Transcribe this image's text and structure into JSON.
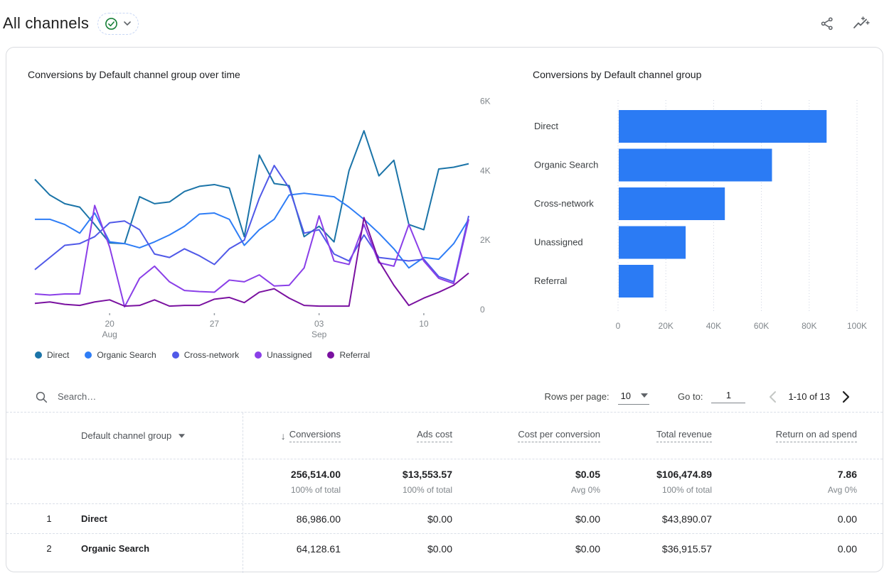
{
  "header": {
    "title": "All channels",
    "status": "verified",
    "accent_green": "#188038",
    "icon_grey": "#5f6368"
  },
  "chart_data": [
    {
      "type": "line",
      "title": "Conversions by Default channel group over time",
      "ylim": [
        0,
        6000
      ],
      "y_ticks": [
        {
          "v": 6000,
          "label": "6K"
        },
        {
          "v": 4000,
          "label": "4K"
        },
        {
          "v": 2000,
          "label": "2K"
        },
        {
          "v": 0,
          "label": "0"
        }
      ],
      "x_points": 30,
      "x_tick_labels": [
        {
          "i": 5,
          "label": "20",
          "sub": "Aug"
        },
        {
          "i": 12,
          "label": "27",
          "sub": ""
        },
        {
          "i": 19,
          "label": "03",
          "sub": "Sep"
        },
        {
          "i": 26,
          "label": "10",
          "sub": ""
        }
      ],
      "grid": false,
      "legend_position": "bottom",
      "series": [
        {
          "name": "Direct",
          "color": "#1b74a8",
          "values": [
            3750,
            3300,
            3050,
            2950,
            2450,
            1920,
            1900,
            3250,
            3050,
            3100,
            3400,
            3550,
            3600,
            3500,
            2100,
            4450,
            3630,
            3570,
            2100,
            2400,
            1950,
            4000,
            5150,
            3850,
            4300,
            2450,
            2300,
            4050,
            4100,
            4200
          ]
        },
        {
          "name": "Organic Search",
          "color": "#2e7df6",
          "values": [
            2600,
            2600,
            2450,
            2200,
            2780,
            1950,
            1900,
            1780,
            1950,
            2150,
            2400,
            2750,
            2780,
            2600,
            1850,
            2300,
            2600,
            3300,
            3350,
            3300,
            3250,
            2950,
            2600,
            2200,
            1750,
            1200,
            1500,
            1450,
            1900,
            2600
          ]
        },
        {
          "name": "Cross-network",
          "color": "#5059e8",
          "values": [
            1150,
            1500,
            1850,
            1900,
            2100,
            2500,
            2550,
            2300,
            1600,
            1500,
            1750,
            1550,
            1300,
            1750,
            2000,
            3200,
            4150,
            3500,
            2200,
            2300,
            1600,
            1400,
            2150,
            1500,
            1450,
            1400,
            1450,
            950,
            800,
            2700
          ]
        },
        {
          "name": "Unassigned",
          "color": "#8a3fe8",
          "values": [
            450,
            420,
            450,
            450,
            3000,
            1800,
            80,
            900,
            1250,
            800,
            550,
            520,
            500,
            850,
            800,
            1000,
            680,
            700,
            1200,
            2700,
            1400,
            1300,
            2450,
            1350,
            1250,
            2450,
            1400,
            900,
            750,
            2600
          ]
        },
        {
          "name": "Referral",
          "color": "#7a11a0",
          "values": [
            180,
            220,
            150,
            120,
            220,
            280,
            100,
            120,
            280,
            100,
            120,
            120,
            300,
            350,
            200,
            500,
            600,
            330,
            120,
            100,
            100,
            100,
            2650,
            1400,
            700,
            120,
            330,
            500,
            700,
            1050
          ]
        }
      ]
    },
    {
      "type": "bar",
      "orientation": "horizontal",
      "title": "Conversions by Default channel group",
      "categories": [
        "Direct",
        "Organic Search",
        "Cross-network",
        "Unassigned",
        "Referral"
      ],
      "values": [
        86986,
        64129,
        44400,
        28000,
        14500
      ],
      "xlim": [
        0,
        112000
      ],
      "x_ticks": [
        {
          "v": 0,
          "label": "0"
        },
        {
          "v": 20000,
          "label": "20K"
        },
        {
          "v": 40000,
          "label": "40K"
        },
        {
          "v": 60000,
          "label": "60K"
        },
        {
          "v": 80000,
          "label": "80K"
        },
        {
          "v": 100000,
          "label": "100K"
        }
      ],
      "bar_color": "#2b7bf4",
      "grid": "dotted-vertical"
    }
  ],
  "table": {
    "search": {
      "placeholder": "Search…"
    },
    "pagination": {
      "rows_per_page_label": "Rows per page:",
      "rows_per_page_value": "10",
      "go_to_label": "Go to:",
      "go_to_value": "1",
      "range_label": "1-10 of 13",
      "prev_enabled": false,
      "next_enabled": true
    },
    "columns": [
      "Default channel group",
      "Conversions",
      "Ads cost",
      "Cost per conversion",
      "Total revenue",
      "Return on ad spend"
    ],
    "sorted_column": "Conversions",
    "sort_direction": "desc",
    "totals": {
      "values": [
        "256,514.00",
        "$13,553.57",
        "$0.05",
        "$106,474.89",
        "7.86"
      ],
      "subtexts": [
        "100% of total",
        "100% of total",
        "Avg 0%",
        "100% of total",
        "Avg 0%"
      ]
    },
    "rows": [
      {
        "index": "1",
        "channel": "Direct",
        "values": [
          "86,986.00",
          "$0.00",
          "$0.00",
          "$43,890.07",
          "0.00"
        ]
      },
      {
        "index": "2",
        "channel": "Organic Search",
        "values": [
          "64,128.61",
          "$0.00",
          "$0.00",
          "$36,915.57",
          "0.00"
        ]
      }
    ]
  }
}
